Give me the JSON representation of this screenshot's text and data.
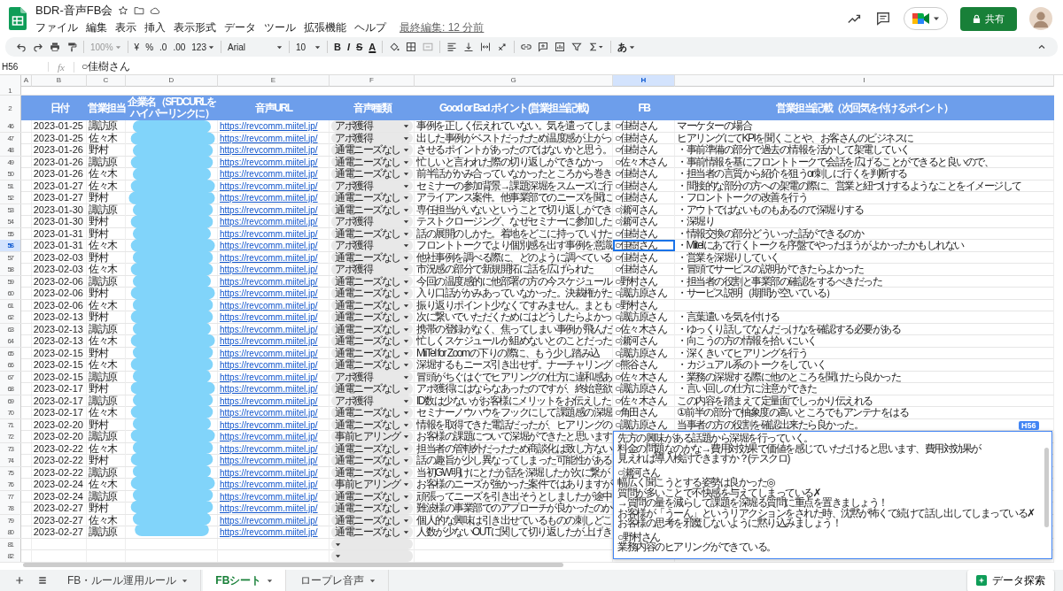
{
  "document": {
    "title": "BDR-音声FB会",
    "last_edit": "最終編集: 12 分前"
  },
  "menu": [
    "ファイル",
    "編集",
    "表示",
    "挿入",
    "表示形式",
    "データ",
    "ツール",
    "拡張機能",
    "ヘルプ"
  ],
  "share_button": "共有",
  "toolbar": {
    "zoom": "100%",
    "currency": "¥",
    "percent": "%",
    "decimal_less": ".0",
    "decimal_more": ".00",
    "number_format": "123",
    "font": "Arial",
    "font_size": "10",
    "bold": "B",
    "italic": "I",
    "strike": "S",
    "text_color": "A",
    "input_tools": "あ"
  },
  "formula_bar": {
    "cell": "H56",
    "fx": "fx",
    "value": "○佳樹さん"
  },
  "columns": [
    {
      "letter": "A",
      "selected": false
    },
    {
      "letter": "B",
      "selected": false
    },
    {
      "letter": "C",
      "selected": false
    },
    {
      "letter": "D",
      "selected": false
    },
    {
      "letter": "E",
      "selected": false
    },
    {
      "letter": "F",
      "selected": false
    },
    {
      "letter": "G",
      "selected": false
    },
    {
      "letter": "H",
      "selected": true
    },
    {
      "letter": "I",
      "selected": false
    }
  ],
  "row_1": {
    "number": "1"
  },
  "header_row": {
    "number": "2",
    "cells": [
      "日付",
      "営業担当",
      "企業名（SFDCURLをハイパーリンクに）",
      "音声URL",
      "音声種類",
      "Good or Bad ポイント(営業担当記載)",
      "FB",
      "営業担当記載（次回気を付けるポイント）"
    ]
  },
  "rows": [
    {
      "number": "46",
      "date": "2023-01-25",
      "rep": "諏訪原",
      "url": "https://revcomm.miitel.jp/",
      "status": "アポ獲得",
      "good_bad": "事例を正しく伝えれていない。気を遣ってしま",
      "fb": "○佳樹さん",
      "note": "マーケターの場合",
      "selected": false
    },
    {
      "number": "47",
      "date": "2023-01-25",
      "rep": "佐々木",
      "url": "https://revcomm.miitel.jp/",
      "status": "アポ獲得",
      "good_bad": "出した事例がベストだったため温度感が上がっ",
      "fb": "○佳樹さん",
      "note": "ヒアリングにてKPIを聞くことや、お客さんのビジネスに",
      "selected": false
    },
    {
      "number": "48",
      "date": "2023-01-26",
      "rep": "野村",
      "url": "https://revcomm.miitel.jp/",
      "status": "通電ニーズなし",
      "good_bad": "させるポイントがあったのではないかと思う。",
      "fb": "○佳樹さん",
      "note": "・事前準備の部分で過去の情報を活かして架電していく",
      "selected": false
    },
    {
      "number": "49",
      "date": "2023-01-26",
      "rep": "諏訪原",
      "url": "https://revcomm.miitel.jp/",
      "status": "通電ニーズなし",
      "good_bad": "忙しいと言われた際の切り返しができなかっ",
      "fb": "○佐々木さん",
      "note": "・事前情報を基にフロントトークで会話を広げることができると良いので、",
      "selected": false
    },
    {
      "number": "50",
      "date": "2023-01-26",
      "rep": "佐々木",
      "url": "https://revcomm.miitel.jp/",
      "status": "通電ニーズなし",
      "good_bad": "前半話がかみ合っていなかったところから巻き",
      "fb": "○佳樹さん",
      "note": "・担当者の言質から紹介を狙うor刺しに行くを判断する",
      "selected": false
    },
    {
      "number": "51",
      "date": "2023-01-27",
      "rep": "佐々木",
      "url": "https://revcomm.miitel.jp/",
      "status": "アポ獲得",
      "good_bad": "セミナーの参加背景→課題深堀をスムーズに行",
      "fb": "○佳樹さん",
      "note": "・間接的な部分の方への架電の際に、営業と紐づけするようなことをイメージして",
      "selected": false
    },
    {
      "number": "52",
      "date": "2023-01-27",
      "rep": "野村",
      "url": "https://revcomm.miitel.jp/",
      "status": "通電ニーズなし",
      "good_bad": "アライアンス案件。他事業部でのニーズを聞に",
      "fb": "○佳樹さん",
      "note": "・フロントトークの改善を行う",
      "selected": false
    },
    {
      "number": "53",
      "date": "2023-01-30",
      "rep": "諏訪原",
      "url": "https://revcomm.miitel.jp/",
      "status": "通電ニーズなし",
      "good_bad": "専任担当がいないということで切り返しができ",
      "fb": "○瀬河さん",
      "note": "・アウトではないものもあるので深堀りする",
      "selected": false
    },
    {
      "number": "54",
      "date": "2023-01-30",
      "rep": "野村",
      "url": "https://revcomm.miitel.jp/",
      "status": "アポ獲得",
      "good_bad": "テストクロージング、なぜセミナーに参加した",
      "fb": "○瀬河さん",
      "note": "・深堀り",
      "selected": false
    },
    {
      "number": "55",
      "date": "2023-01-31",
      "rep": "野村",
      "url": "https://revcomm.miitel.jp/",
      "status": "通電ニーズなし",
      "good_bad": "話の展開のしかた。着地をどこに持っていけた",
      "fb": "○佳樹さん",
      "note": "・情報交換の部分どういった話ができるのか",
      "selected": false
    },
    {
      "number": "56",
      "date": "2023-01-31",
      "rep": "佐々木",
      "url": "https://revcomm.miitel.jp/",
      "status": "アポ獲得",
      "good_bad": "フロントトークでより個別感を出す事例を意識",
      "fb": "○佳樹さん",
      "note": "・Miitelにあて行くトークを序盤でやったほうがよかったかもしれない",
      "selected": true
    },
    {
      "number": "57",
      "date": "2023-02-03",
      "rep": "野村",
      "url": "https://revcomm.miitel.jp/",
      "status": "通電ニーズなし",
      "good_bad": "他社事例を調べる際に、どのように調べている",
      "fb": "○佳樹さん",
      "note": "・営業を深堀りしていく",
      "selected": false
    },
    {
      "number": "58",
      "date": "2023-02-03",
      "rep": "佐々木",
      "url": "https://revcomm.miitel.jp/",
      "status": "アポ獲得",
      "good_bad": "市況感の部分で新規開拓に話を広げられた",
      "fb": "○佳樹さん",
      "note": "・冒頭でサービスの説明ができたらよかった",
      "selected": false
    },
    {
      "number": "59",
      "date": "2023-02-06",
      "rep": "諏訪原",
      "url": "https://revcomm.miitel.jp/",
      "status": "通電ニーズなし",
      "good_bad": "今回の温度感的に他部署の方の今スケジュール",
      "fb": "○野村さん",
      "note": "・担当者の役割と事業部の確認をするべきだった",
      "selected": false
    },
    {
      "number": "60",
      "date": "2023-02-06",
      "rep": "野村",
      "url": "https://revcomm.miitel.jp/",
      "status": "通電ニーズなし",
      "good_bad": "入り口話がかみあっていなかった。決裁権がた",
      "fb": "○諏訪原さん",
      "note": "・サービス説明（期間が空いている）",
      "selected": false
    },
    {
      "number": "61",
      "date": "2023-02-06",
      "rep": "佐々木",
      "url": "https://revcomm.miitel.jp/",
      "status": "通電ニーズなし",
      "good_bad": "振り返りポイント少なくてすみません。まとも",
      "fb": "○野村さん",
      "selected": false
    },
    {
      "number": "62",
      "date": "2023-02-13",
      "rep": "野村",
      "url": "https://revcomm.miitel.jp/",
      "status": "通電ニーズなし",
      "good_bad": "次に繋いでいただくためにはどうしたらよかっ",
      "fb": "○諏訪原さん",
      "note": "・言葉遣いを気を付ける",
      "selected": false
    },
    {
      "number": "63",
      "date": "2023-02-13",
      "rep": "諏訪原",
      "url": "https://revcomm.miitel.jp/",
      "status": "通電ニーズなし",
      "good_bad": "携帯の登録がなく、焦ってしまい事例が飛んだ",
      "fb": "○佐々木さん",
      "note": "・ゆっくり話してなんだっけなを確認する必要がある",
      "selected": false
    },
    {
      "number": "64",
      "date": "2023-02-13",
      "rep": "佐々木",
      "url": "https://revcomm.miitel.jp/",
      "status": "通電ニーズなし",
      "good_bad": "忙しくスケジュールが組めないとのことだった",
      "fb": "○瀬河さん",
      "note": "・向こうの方の情報を拾いにいく",
      "selected": false
    },
    {
      "number": "65",
      "date": "2023-02-15",
      "rep": "野村",
      "url": "https://revcomm.miitel.jp/",
      "status": "通電ニーズなし",
      "good_bad": "MiiTel for Zoomの下りの際に、もう少し踏み込",
      "fb": "○諏訪原さん",
      "note": "・深くきいてヒアリングを行う",
      "selected": false
    },
    {
      "number": "66",
      "date": "2023-02-15",
      "rep": "佐々木",
      "url": "https://revcomm.miitel.jp/",
      "status": "通電ニーズなし",
      "good_bad": "深堀するもニーズ引き出せず。ナーチャリング",
      "fb": "○熊谷さん",
      "note": "・カジュアル系のトークをしていく",
      "selected": false
    },
    {
      "number": "67",
      "date": "2023-02-15",
      "rep": "諏訪原",
      "url": "https://revcomm.miitel.jp/",
      "status": "アポ獲得",
      "good_bad": "冒頭がちぐはぐでヒアリングの仕方に違和感あ",
      "fb": "○佐々木さん",
      "note": "・業務の深堀する際に他のところを聞けたら良かった",
      "selected": false
    },
    {
      "number": "68",
      "date": "2023-02-17",
      "rep": "野村",
      "url": "https://revcomm.miitel.jp/",
      "status": "通電ニーズなし",
      "good_bad": "アポ獲得にはならなあったのですが、終始意欲",
      "fb": "○諏訪原さん",
      "note": "・言い回しの仕方に注意ができた",
      "selected": false
    },
    {
      "number": "69",
      "date": "2023-02-17",
      "rep": "諏訪原",
      "url": "https://revcomm.miitel.jp/",
      "status": "アポ獲得",
      "good_bad": "ID数は少ないがお客様にメリットをお伝えした",
      "fb": "○佐々木さん",
      "note": "この内容を踏まえて定量面でしっかり伝えれる",
      "selected": false
    },
    {
      "number": "70",
      "date": "2023-02-17",
      "rep": "佐々木",
      "url": "https://revcomm.miitel.jp/",
      "status": "通電ニーズなし",
      "good_bad": "セミナーノウハウをフックにして課題感の深堀",
      "fb": "○角田さん",
      "note": "①前半の部分で抽象度の高いところでもアンテナをはる",
      "selected": false
    },
    {
      "number": "71",
      "date": "2023-02-20",
      "rep": "野村",
      "url": "https://revcomm.miitel.jp/",
      "status": "通電ニーズなし",
      "good_bad": "情報を取得できた電話だったが、ヒアリングの",
      "fb": "○諏訪原さん",
      "note": "当事者の方の役割を確認出来たら良かった。",
      "selected": false
    },
    {
      "number": "72",
      "date": "2023-02-20",
      "rep": "諏訪原",
      "url": "https://revcomm.miitel.jp/",
      "status": "事前ヒアリング",
      "good_bad": "お客様の課題について深堀ができたと思います",
      "selected": false
    },
    {
      "number": "73",
      "date": "2023-02-22",
      "rep": "佐々木",
      "url": "https://revcomm.miitel.jp/",
      "status": "通電ニーズなし",
      "good_bad": "担当者の管轄外だったため商談化は致し方ない",
      "selected": false
    },
    {
      "number": "74",
      "date": "2023-02-22",
      "rep": "野村",
      "url": "https://revcomm.miitel.jp/",
      "status": "通電ニーズなし",
      "good_bad": "話の趣旨が少し異なってしまった可能性がある",
      "selected": false
    },
    {
      "number": "75",
      "date": "2023-02-22",
      "rep": "諏訪原",
      "url": "https://revcomm.miitel.jp/",
      "status": "通電ニーズなし",
      "good_bad": "当初GW明けにとだが話を深堀したが次に繋が",
      "selected": false
    },
    {
      "number": "76",
      "date": "2023-02-24",
      "rep": "佐々木",
      "url": "https://revcomm.miitel.jp/",
      "status": "事前ヒアリング",
      "good_bad": "お客様のニーズが強かった案件ではありますが",
      "selected": false
    },
    {
      "number": "77",
      "date": "2023-02-24",
      "rep": "諏訪原",
      "url": "https://revcomm.miitel.jp/",
      "status": "通電ニーズなし",
      "good_bad": "頑張ってニーズを引き出そうとしましたが途中",
      "selected": false
    },
    {
      "number": "78",
      "date": "2023-02-27",
      "rep": "野村",
      "url": "https://revcomm.miitel.jp/",
      "status": "通電ニーズなし",
      "good_bad": "難波様の事業部でのアプローチが良かったのか",
      "selected": false
    },
    {
      "number": "79",
      "date": "2023-02-27",
      "rep": "佐々木",
      "url": "https://revcomm.miitel.jp/",
      "status": "通電ニーズなし",
      "good_bad": "個人的な興味は引き出せているものの刺しどこ",
      "selected": false
    },
    {
      "number": "80",
      "date": "2023-02-27",
      "rep": "諏訪原",
      "url": "https://revcomm.miitel.jp/",
      "status": "通電ニーズなし",
      "good_bad": "人数が少ないOUTに関して切り返したが上げき",
      "selected": false
    },
    {
      "number": "81",
      "selected": false
    },
    {
      "number": "82",
      "selected": false
    }
  ],
  "cell_editor": {
    "cell": "H56",
    "paragraphs": [
      [
        "先方の興味がある話題から深堀を行っていく。",
        "料金の問題なのかな→費用対効果で価値を感じていただけると思います、費用対効果が",
        "見えれば導入検討できますか？(テスクロ)"
      ],
      [
        "○瀬河さん",
        "幅広く聞こうとする姿勢は良かった◎",
        "質問が多いことで不快感を与えてしまっている✗",
        "→質問の量を減らして課題を深堀る質問に重点を置きましょう！",
        "お客様が「うーん」というリアクションをされた時、沈黙が怖くて続けて話し出してしまっている✗",
        "お客様の思考を邪魔しないように黙り込みましょう！"
      ],
      [
        "○野村さん",
        "業務内容のヒアリングができている。"
      ]
    ]
  },
  "sheet_tabs": [
    {
      "label": "FB・ルール運用ルール",
      "selected": false
    },
    {
      "label": "FBシート",
      "selected": true
    },
    {
      "label": "ロープレ音声",
      "selected": false
    }
  ],
  "explore_button": "データ探索"
}
